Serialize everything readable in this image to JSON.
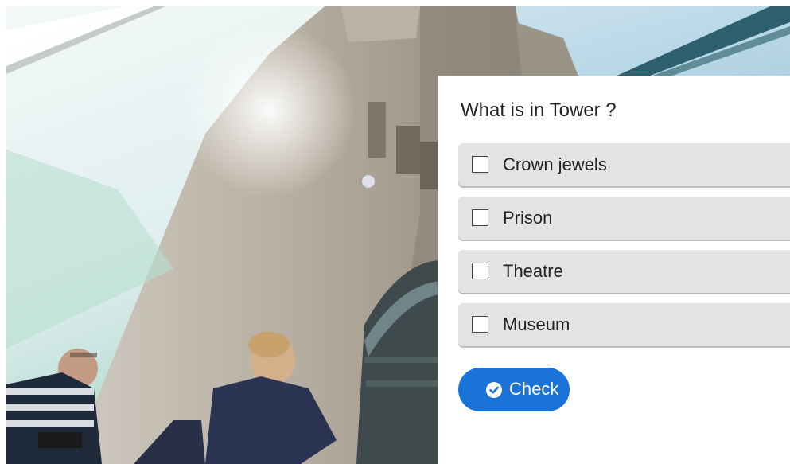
{
  "quiz": {
    "question": "What is in Tower ?",
    "options": [
      {
        "label": "Crown jewels",
        "checked": false
      },
      {
        "label": "Prison",
        "checked": false
      },
      {
        "label": "Theatre",
        "checked": false
      },
      {
        "label": "Museum",
        "checked": false
      }
    ],
    "check_button": {
      "label": "Check",
      "icon": "check-circle-icon"
    }
  },
  "colors": {
    "button_blue": "#1a73d9",
    "option_bg": "#e3e3e3",
    "panel_bg": "#ffffff"
  }
}
